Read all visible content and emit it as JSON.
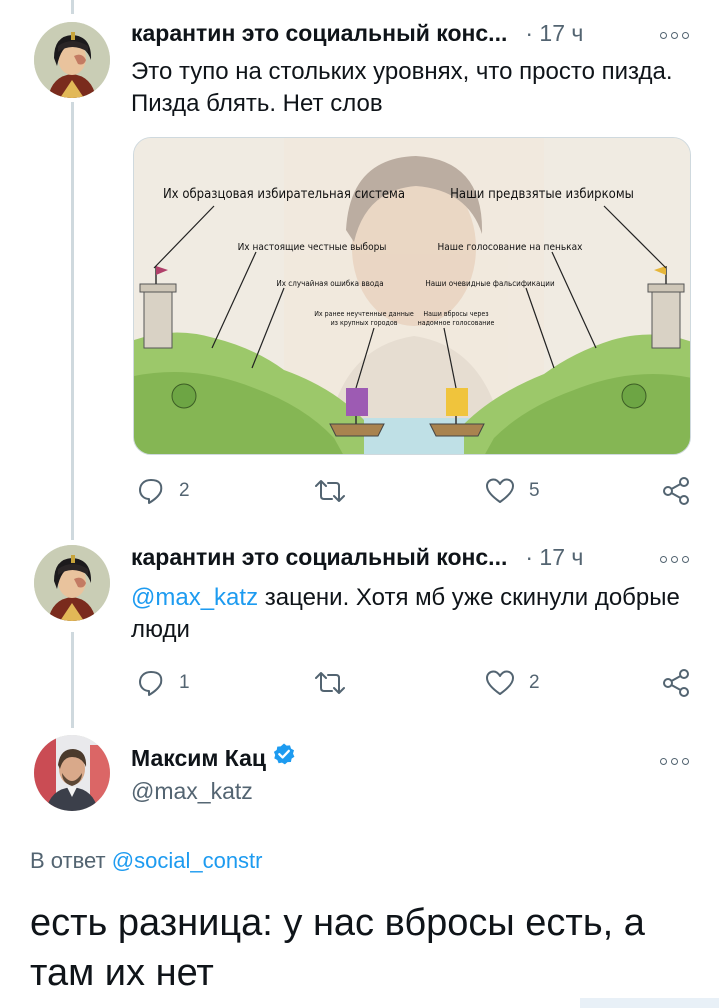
{
  "tweets": [
    {
      "author_name": "карантин это социальный конс...",
      "time": "· 17 ч",
      "text": "Это тупо на стольких уровнях, что просто пизда. Пизда блять. Нет слов",
      "replies": "2",
      "retweets": "",
      "likes": "5",
      "avatar_icon": "avatar-icon"
    },
    {
      "author_name": "карантин это социальный конс...",
      "time": "· 17 ч",
      "mention": "@max_katz",
      "text": "зацени. Хотя мб уже скинули добрые люди",
      "replies": "1",
      "retweets": "",
      "likes": "2"
    }
  ],
  "meme_image": {
    "left_title": "Их образцовая избирательная система",
    "right_title": "Наши предвзятые избиркомы",
    "left_labels": [
      "Их настоящие честные выборы",
      "Их случайная ошибка ввода",
      "Их ранее неучтенные данные",
      "из крупных городов"
    ],
    "right_labels": [
      "Наше голосование на пеньках",
      "Наши очевидные фальсификации",
      "Наши вбросы через",
      "надомное голосование"
    ]
  },
  "reply": {
    "author_name": "Максим Кац",
    "handle": "@max_katz",
    "reply_prefix": "В ответ",
    "reply_to": "@social_constr",
    "text": "есть разница: у нас вбросы есть, а там их нет"
  },
  "colors": {
    "accent": "#1d9bf0",
    "muted": "#536471",
    "verified": "#1d9bf0"
  }
}
